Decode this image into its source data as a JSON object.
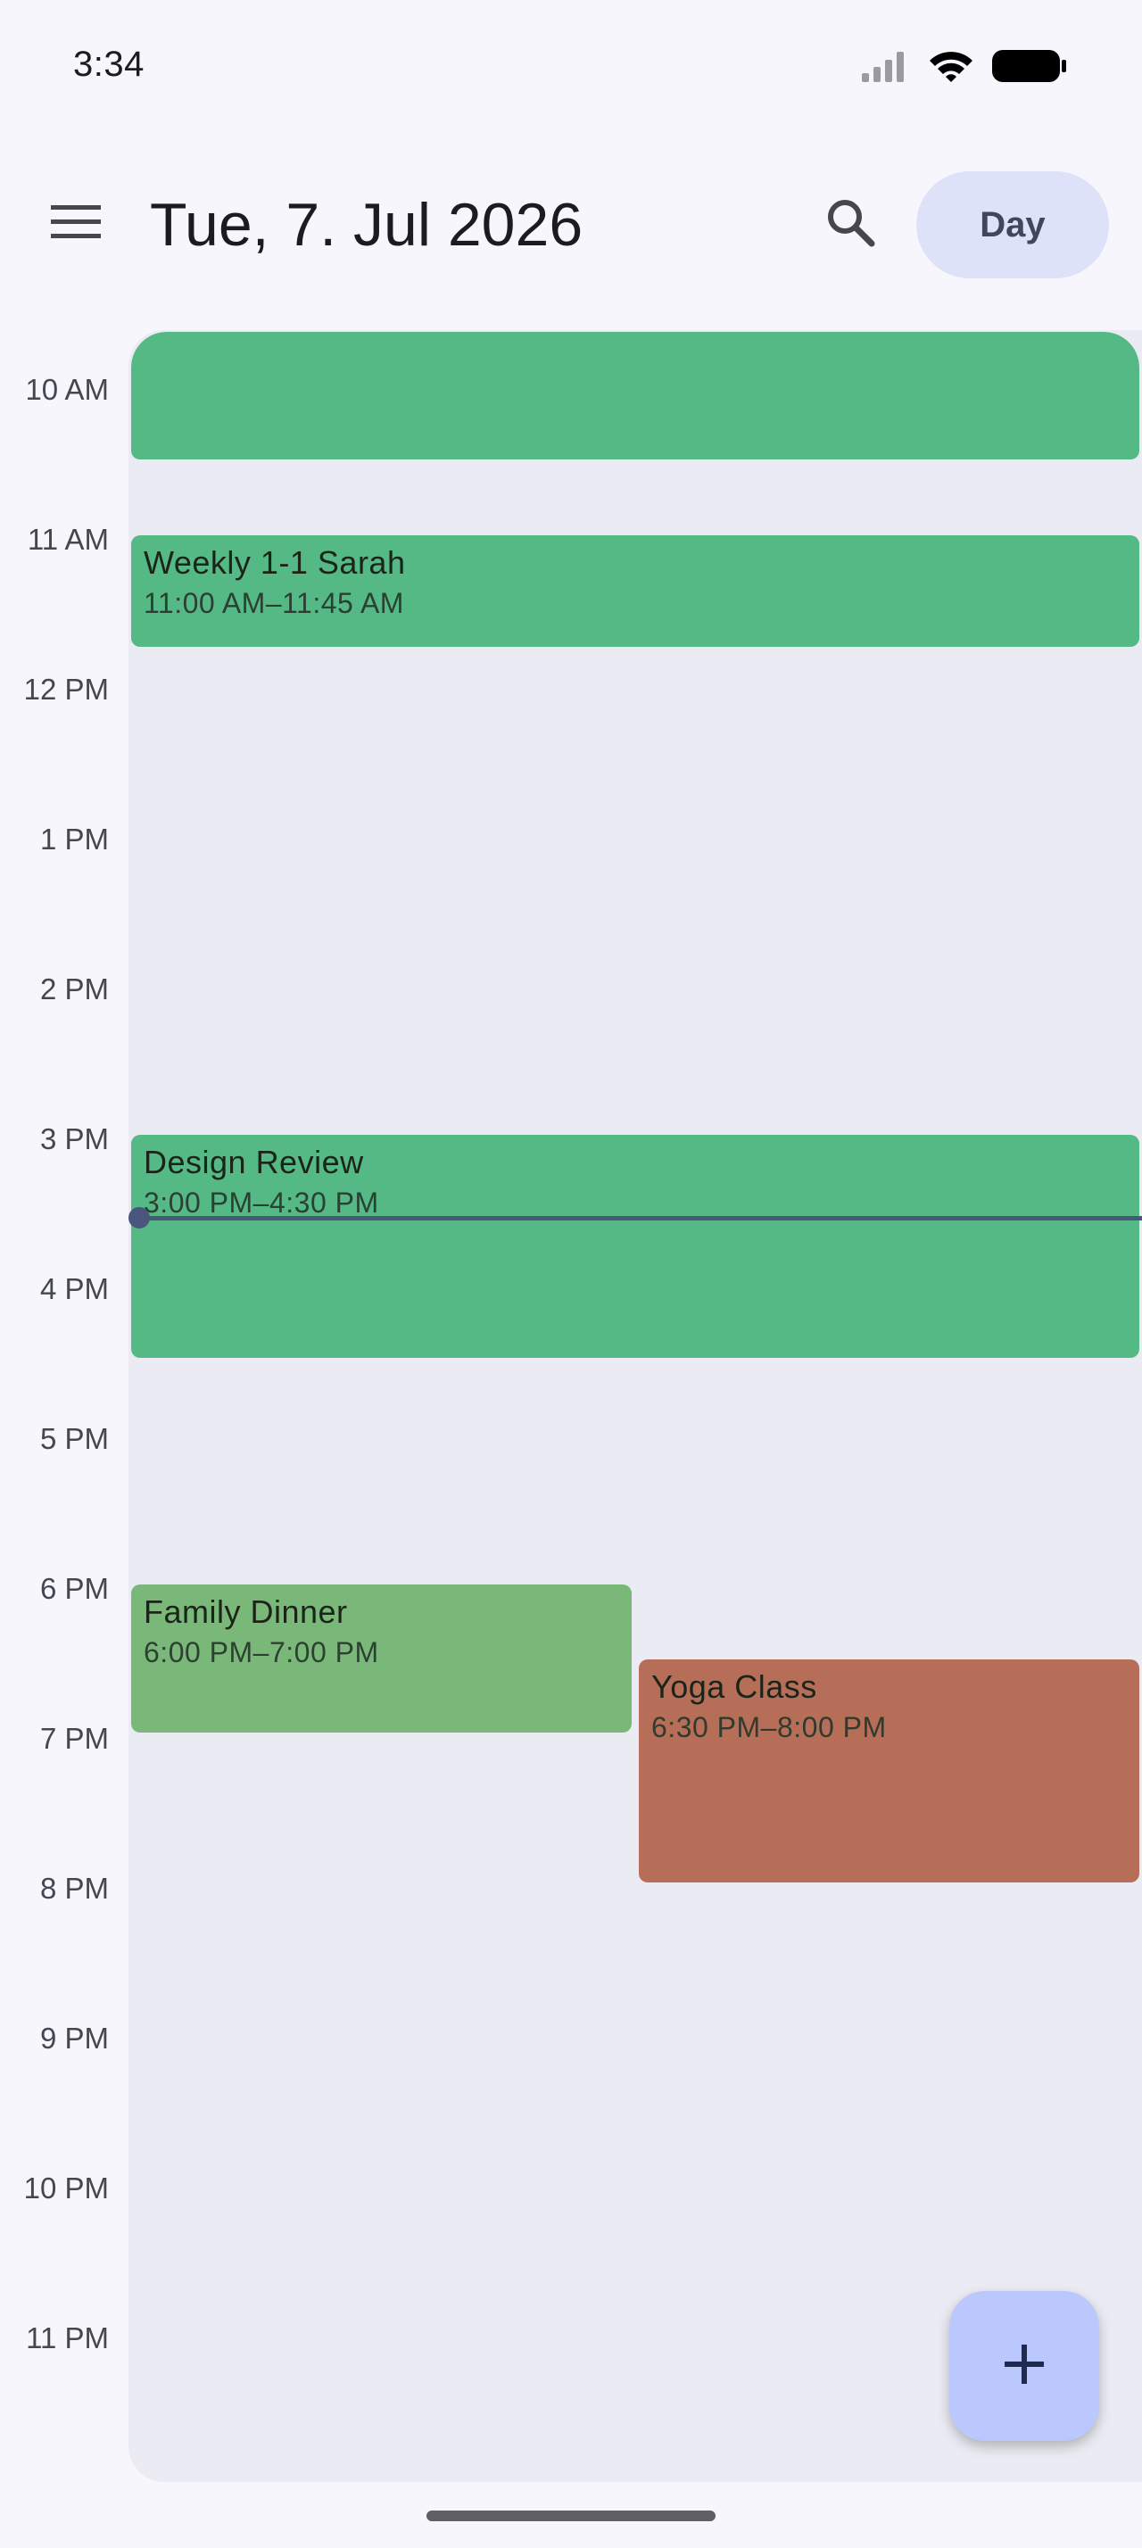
{
  "status_bar": {
    "time": "3:34",
    "icons": [
      "signal-icon",
      "wifi-icon",
      "battery-icon"
    ]
  },
  "top_bar": {
    "menu_icon": "menu-icon",
    "date_title": "Tue, 7. Jul 2026",
    "search_icon": "search-icon",
    "view_mode_label": "Day"
  },
  "hours": [
    "10 AM",
    "11 AM",
    "12 PM",
    "1 PM",
    "2 PM",
    "3 PM",
    "4 PM",
    "5 PM",
    "6 PM",
    "7 PM",
    "8 PM",
    "9 PM",
    "10 PM",
    "11 PM"
  ],
  "events": [
    {
      "title": "",
      "time": "",
      "color": "#55b985"
    },
    {
      "title": "Weekly 1-1 Sarah",
      "time": "11:00 AM–11:45 AM",
      "color": "#55b985"
    },
    {
      "title": "Design Review",
      "time": "3:00 PM–4:30 PM",
      "color": "#55b985"
    },
    {
      "title": "Family Dinner",
      "time": "6:00 PM–7:00 PM",
      "color": "#7ab87a"
    },
    {
      "title": "Yoga Class",
      "time": "6:30 PM–8:00 PM",
      "color": "#b76e58"
    }
  ],
  "current_time_indicator_color": "#4a567c",
  "fab": {
    "icon": "plus-icon",
    "color": "#bac8fd"
  }
}
